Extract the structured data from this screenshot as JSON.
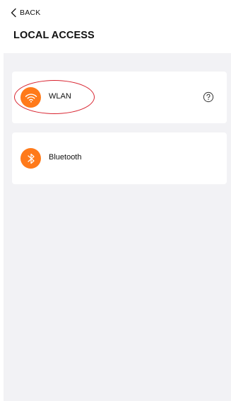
{
  "header": {
    "back_label": "BACK",
    "title": "LOCAL ACCESS"
  },
  "options": [
    {
      "label": "WLAN",
      "icon": "wifi-icon",
      "has_help": true,
      "highlighted": true
    },
    {
      "label": "Bluetooth",
      "icon": "bluetooth-icon",
      "has_help": false,
      "highlighted": false
    }
  ],
  "colors": {
    "accent": "#ff7a1a",
    "highlight": "#d8222e",
    "background": "#f2f2f5",
    "card": "#ffffff"
  }
}
